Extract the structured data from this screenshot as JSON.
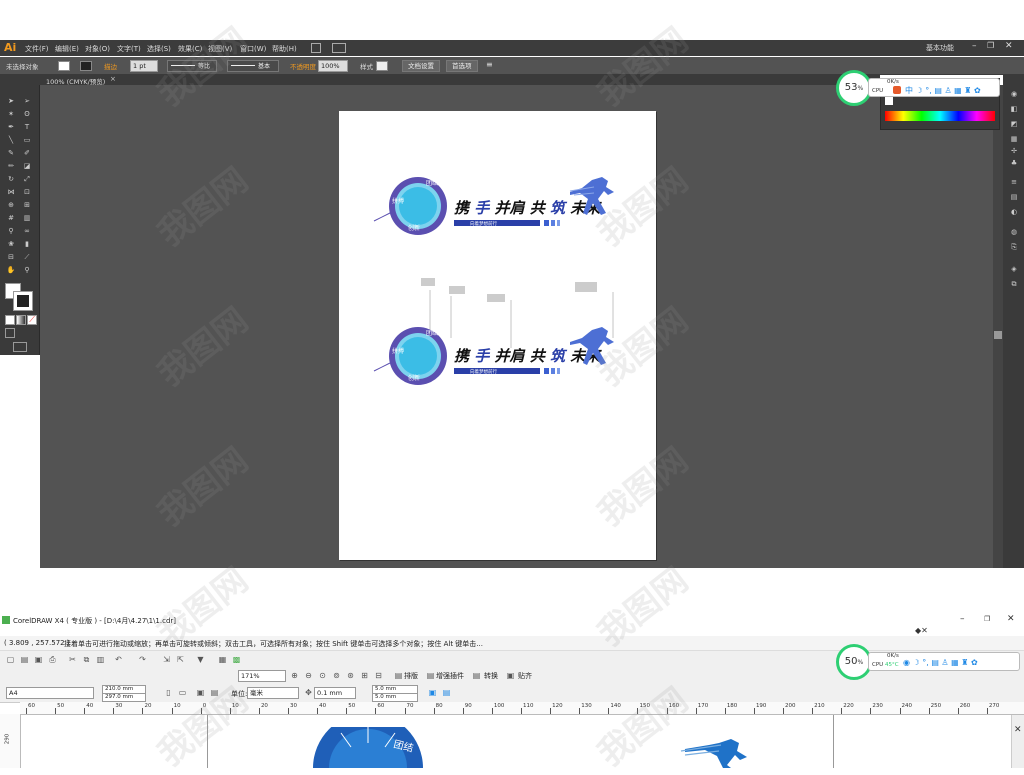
{
  "ai": {
    "logo": "Ai",
    "menu": [
      "文件(F)",
      "编辑(E)",
      "对象(O)",
      "文字(T)",
      "选择(S)",
      "效果(C)",
      "视图(V)",
      "窗口(W)",
      "帮助(H)"
    ],
    "workspace": "基本功能",
    "control": {
      "selection": "未选择对象",
      "stroke_label": "描边",
      "stroke_width": "1 pt",
      "profile": "等比",
      "brush": "基本",
      "opacity_label": "不透明度",
      "opacity": "100%",
      "style_label": "样式",
      "doc_setup": "文档设置",
      "preferences": "首选项"
    },
    "tab": "100% (CMYK/预览)",
    "tab_close": "×",
    "badge": {
      "value": "53",
      "unit": "%"
    },
    "net": {
      "speed": "0K/s",
      "cpu": "CPU"
    },
    "artwork": {
      "slogan_a": "携",
      "slogan_b": "手",
      "slogan_c": "并肩 共",
      "slogan_d": "筑",
      "slogan_e": "未来",
      "subtitle": "向着梦想前行",
      "seg1": "团结",
      "seg2": "拼搏",
      "seg3": "创新"
    }
  },
  "cd": {
    "title": "CorelDRAW X4 ( 专业版 ) - [D:\\4月\\4.27\\1\\1.cdr]",
    "coords": "( 3.809 , 257.572 )",
    "hint": "接着单击可进行拖动或缩放；再单击可旋转或倾斜；双击工具，可选择所有对象；按住 Shift 键单击可选择多个对象；按住 Alt 键单击...",
    "zoom": "171%",
    "buttons": [
      "排版",
      "增强插件",
      "转换",
      "贴齐"
    ],
    "page_size": "A4",
    "width": "210.0 mm",
    "height": "297.0 mm",
    "unit_label": "单位:",
    "unit": "毫米",
    "nudge": "0.1 mm",
    "dup_x": "5.0 mm",
    "dup_y": "5.0 mm",
    "badge": {
      "value": "50",
      "unit": "%"
    },
    "net": {
      "speed": "0K/s",
      "cpu": "CPU",
      "temp": "45°C"
    },
    "ruler": [
      "60",
      "50",
      "40",
      "30",
      "20",
      "10",
      "0",
      "10",
      "20",
      "30",
      "40",
      "50",
      "60",
      "70",
      "80",
      "90",
      "100",
      "110",
      "120",
      "130",
      "140",
      "150",
      "160",
      "170",
      "180",
      "190",
      "200",
      "210",
      "220",
      "230",
      "240",
      "250",
      "260",
      "270"
    ],
    "vruler": "290",
    "art_label": "团结"
  },
  "watermark": "我图网",
  "colors": {
    "accent_blue": "#2a3fa8",
    "cyan": "#3bbde6",
    "purple": "#5b4fb0",
    "badge_green": "#2ecf73"
  }
}
